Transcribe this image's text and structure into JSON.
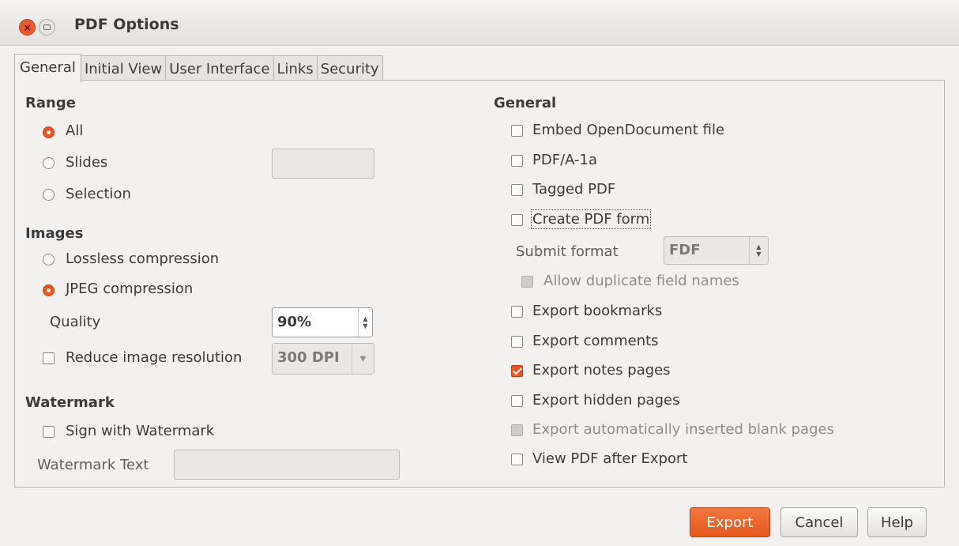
{
  "window": {
    "title": "PDF Options"
  },
  "tabs": [
    "General",
    "Initial View",
    "User Interface",
    "Links",
    "Security"
  ],
  "left": {
    "range": {
      "heading": "Range",
      "all": {
        "label": "All",
        "checked": true
      },
      "slides": {
        "label": "Slides",
        "value": ""
      },
      "selection": {
        "label": "Selection"
      }
    },
    "images": {
      "heading": "Images",
      "lossless": {
        "label": "Lossless compression"
      },
      "jpeg": {
        "label": "JPEG compression",
        "checked": true
      },
      "quality": {
        "label": "Quality",
        "value": "90%"
      },
      "reduce": {
        "label": "Reduce image resolution",
        "value": "300 DPI"
      }
    },
    "watermark": {
      "heading": "Watermark",
      "sign": {
        "label": "Sign with Watermark"
      },
      "text": {
        "label": "Watermark Text",
        "value": ""
      }
    }
  },
  "right": {
    "heading": "General",
    "embed": "Embed OpenDocument file",
    "pdfa": "PDF/A-1a",
    "tagged": "Tagged PDF",
    "form": "Create PDF form",
    "submit_format": {
      "label": "Submit format",
      "value": "FDF"
    },
    "allow_duplicate": "Allow duplicate field names",
    "bookmarks": "Export bookmarks",
    "comments": "Export comments",
    "notes": "Export notes pages",
    "hidden": "Export hidden pages",
    "blank": "Export automatically inserted blank pages",
    "view_after": "View PDF after Export"
  },
  "buttons": {
    "export": "Export",
    "cancel": "Cancel",
    "help": "Help"
  },
  "colors": {
    "accent": "#e95420",
    "background": "#f2f1f0"
  }
}
